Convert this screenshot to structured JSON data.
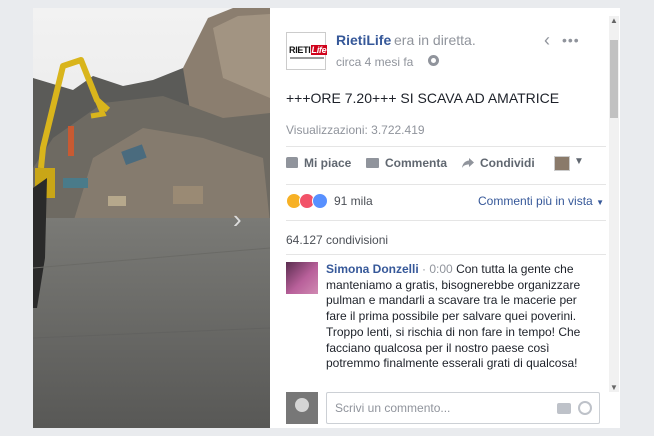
{
  "post": {
    "page_name": "RietiLife",
    "status": "era in diretta.",
    "time": "circa 4 mesi fa",
    "logo_left": "RIETI",
    "logo_right": "Life",
    "text": "+++ORE 7.20+++ SI SCAVA AD AMATRICE",
    "views": "Visualizzazioni: 3.722.419"
  },
  "actions": {
    "like": "Mi piace",
    "comment": "Commenta",
    "share": "Condividi"
  },
  "reactions": {
    "types": [
      "sad",
      "love",
      "like"
    ],
    "count": "91 mila",
    "sort_label": "Commenti più in vista"
  },
  "shares": "64.127 condivisioni",
  "comments": [
    {
      "author": "Simona Donzelli",
      "time": "0:00",
      "text": "Con tutta la gente che manteniamo a gratis, bisognerebbe organizzare pulman e mandarli a scavare tra le macerie per fare il prima possibile per salvare quei poverini. Troppo lenti, si rischia di non fare in tempo! Che facciano qualcosa per il nostro paese così potremmo finalmente esserali grati di qualcosa!"
    }
  ],
  "composer": {
    "placeholder": "Scrivi un commento..."
  }
}
